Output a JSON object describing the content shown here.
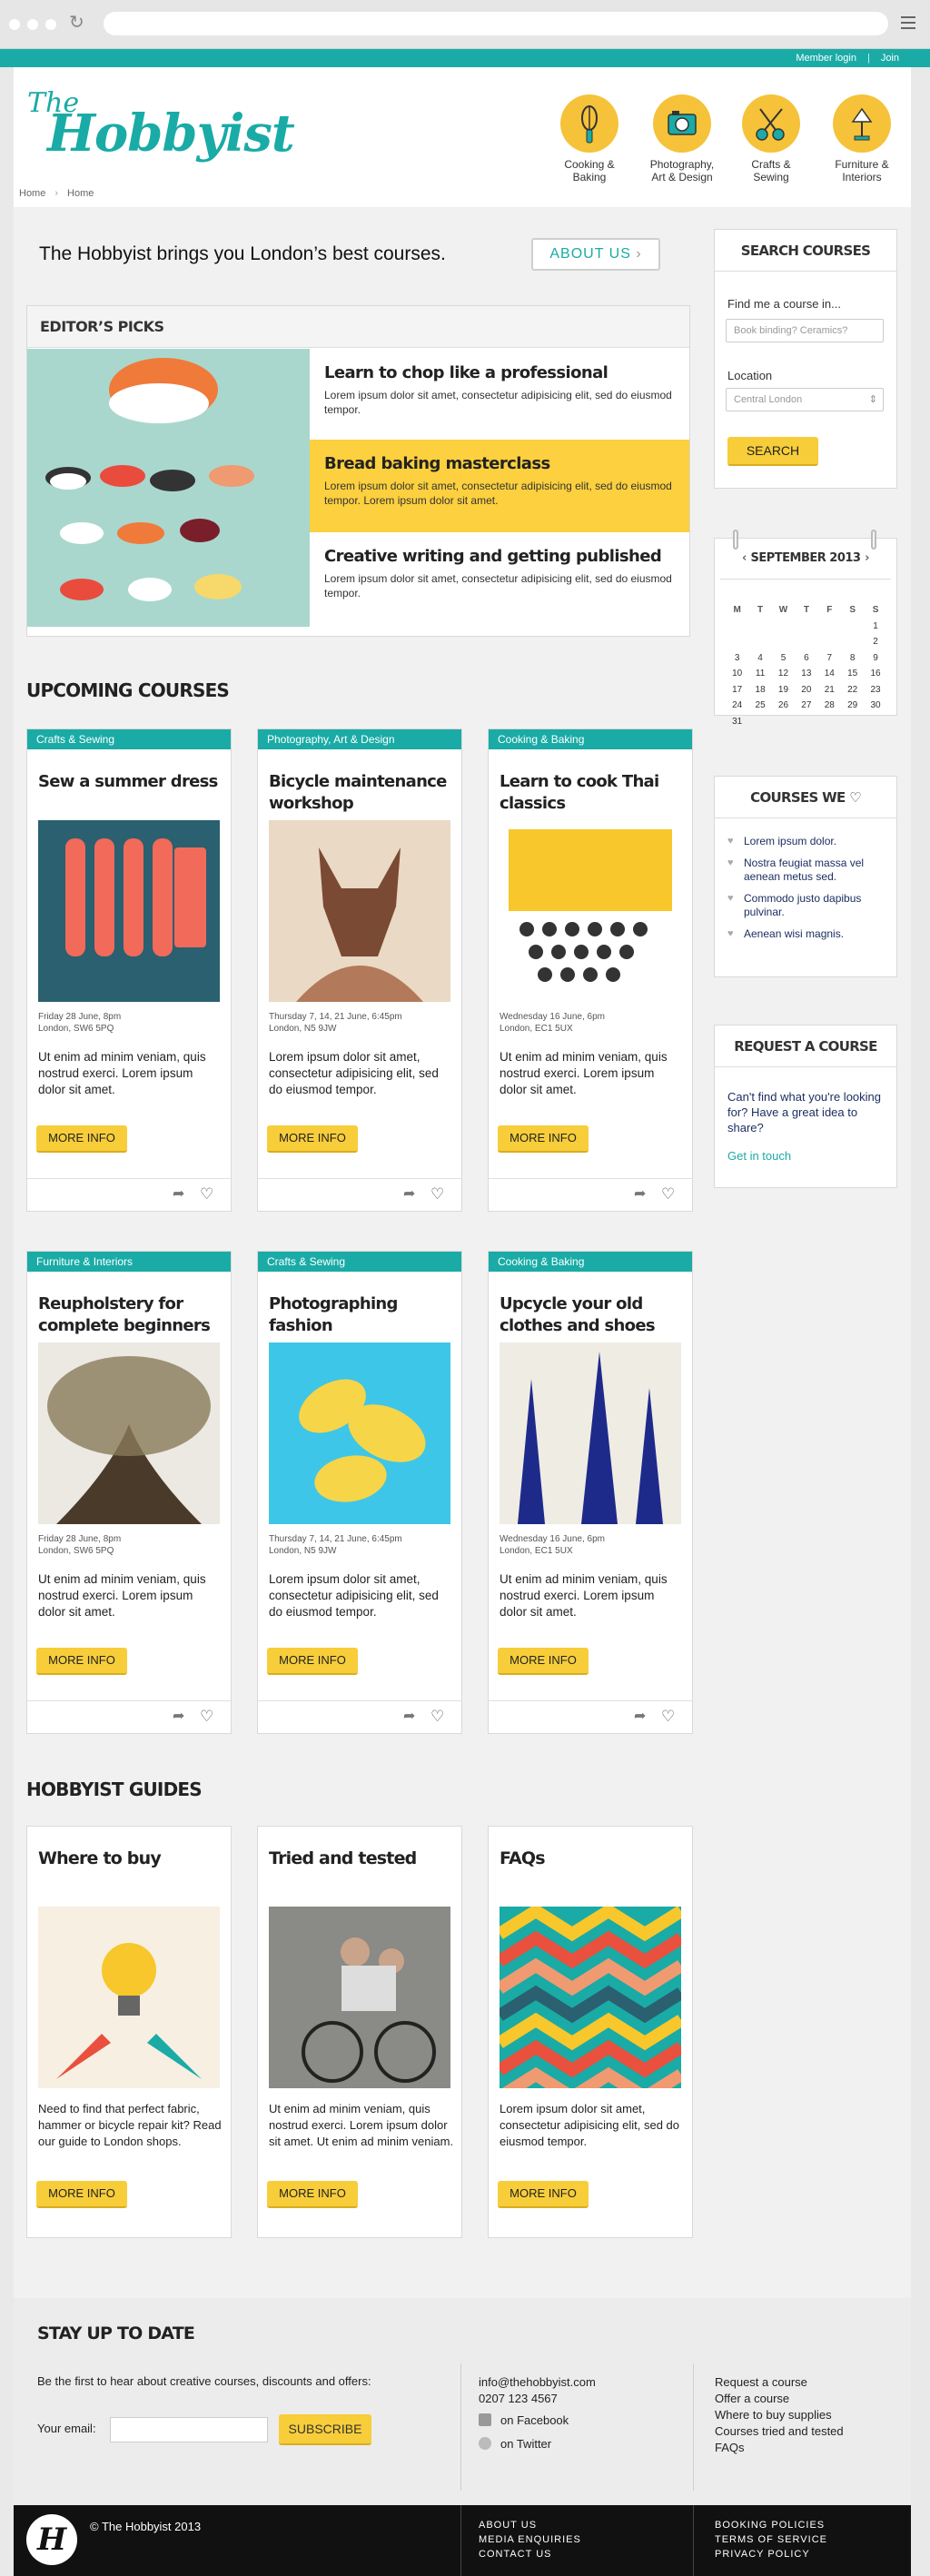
{
  "header": {
    "member_login": "Member login",
    "join": "Join",
    "logo_line1": "The",
    "logo_line2": "Hobbyist"
  },
  "categories": [
    {
      "label": "Cooking &\nBaking",
      "icon": "whisk-icon"
    },
    {
      "label": "Photography,\nArt & Design",
      "icon": "camera-icon"
    },
    {
      "label": "Crafts &\nSewing",
      "icon": "scissors-icon"
    },
    {
      "label": "Furniture &\nInteriors",
      "icon": "lamp-icon"
    }
  ],
  "breadcrumb": [
    "Home",
    "Home"
  ],
  "about": {
    "text": "The Hobbyist brings you London’s best courses.",
    "button": "ABOUT US"
  },
  "editors_picks": {
    "heading": "EDITOR’S PICKS",
    "items": [
      {
        "title": "Learn to chop like a professional",
        "desc": "Lorem ipsum dolor sit amet, consectetur adipisicing elit, sed do eiusmod tempor."
      },
      {
        "title": "Bread baking masterclass",
        "desc": "Lorem ipsum dolor sit amet, consectetur adipisicing elit, sed do eiusmod tempor. Lorem ipsum dolor sit amet."
      },
      {
        "title": "Creative writing and getting published",
        "desc": "Lorem ipsum dolor sit amet, consectetur adipisicing elit, sed do eiusmod tempor."
      }
    ]
  },
  "upcoming": {
    "heading": "UPCOMING COURSES",
    "more_label": "MORE INFO",
    "courses": [
      {
        "category": "Crafts & Sewing",
        "title": "Sew a summer dress",
        "date": "Friday 28 June, 8pm",
        "location": "London, SW6 5PQ",
        "desc": "Ut enim ad minim veniam, quis nostrud exerci. Lorem ipsum dolor sit amet."
      },
      {
        "category": "Photography, Art & Design",
        "title": "Bicycle maintenance workshop",
        "date": "Thursday 7, 14, 21 June, 6:45pm",
        "location": "London, N5 9JW",
        "desc": "Lorem ipsum dolor sit amet, consectetur adipisicing elit, sed do eiusmod tempor."
      },
      {
        "category": "Cooking & Baking",
        "title": "Learn to cook Thai classics",
        "date": "Wednesday 16 June, 6pm",
        "location": "London, EC1 5UX",
        "desc": "Ut enim ad minim veniam, quis nostrud exerci. Lorem ipsum dolor sit amet."
      },
      {
        "category": "Furniture & Interiors",
        "title": "Reupholstery for complete beginners",
        "date": "Friday 28 June, 8pm",
        "location": "London, SW6 5PQ",
        "desc": "Ut enim ad minim veniam, quis nostrud exerci. Lorem ipsum dolor sit amet."
      },
      {
        "category": "Crafts & Sewing",
        "title": "Photographing fashion",
        "date": "Thursday 7, 14, 21 June, 6:45pm",
        "location": "London, N5 9JW",
        "desc": "Lorem ipsum dolor sit amet, consectetur adipisicing elit, sed do eiusmod tempor."
      },
      {
        "category": "Cooking & Baking",
        "title": "Upcycle your old clothes and shoes",
        "date": "Wednesday 16 June, 6pm",
        "location": "London, EC1 5UX",
        "desc": "Ut enim ad minim veniam, quis nostrud exerci. Lorem ipsum dolor sit amet."
      }
    ]
  },
  "guides": {
    "heading": "HOBBYIST GUIDES",
    "more_label": "MORE INFO",
    "items": [
      {
        "title": "Where to buy",
        "desc": "Need to find that perfect fabric, hammer or bicycle repair kit? Read our guide to London shops."
      },
      {
        "title": "Tried and tested",
        "desc": "Ut enim ad minim veniam, quis nostrud exerci. Lorem ipsum dolor sit amet. Ut enim ad minim veniam."
      },
      {
        "title": "FAQs",
        "desc": "Lorem ipsum dolor sit amet, consectetur adipisicing elit, sed do eiusmod tempor."
      }
    ]
  },
  "search": {
    "heading": "SEARCH COURSES",
    "find_label": "Find me a course in...",
    "find_placeholder": "Book binding? Ceramics?",
    "location_label": "Location",
    "location_value": "Central London",
    "button": "SEARCH"
  },
  "calendar": {
    "month": "SEPTEMBER 2013",
    "days": [
      "M",
      "T",
      "W",
      "T",
      "F",
      "S",
      "S"
    ],
    "weeks": [
      [
        "",
        "",
        "",
        "",
        "",
        "",
        "1"
      ],
      [
        "",
        "",
        "",
        "",
        "",
        "",
        "2"
      ],
      [
        "3",
        "4",
        "5",
        "6",
        "7",
        "8",
        "9"
      ],
      [
        "10",
        "11",
        "12",
        "13",
        "14",
        "15",
        "16"
      ],
      [
        "17",
        "18",
        "19",
        "20",
        "21",
        "22",
        "23"
      ],
      [
        "24",
        "25",
        "26",
        "27",
        "28",
        "29",
        "30"
      ],
      [
        "31",
        "",
        "",
        "",
        "",
        "",
        ""
      ]
    ]
  },
  "courses_we_like": {
    "heading": "COURSES WE",
    "items": [
      "Lorem ipsum dolor.",
      "Nostra feugiat massa vel aenean metus sed.",
      "Commodo justo dapibus pulvinar.",
      "Aenean wisi magnis."
    ]
  },
  "request": {
    "heading": "REQUEST A COURSE",
    "text": "Can't find what you're looking for? Have a great idea to share?",
    "link": "Get in touch"
  },
  "footer": {
    "stay_heading": "STAY UP TO DATE",
    "stay_text": "Be the first to hear about creative courses, discounts and offers:",
    "email_label": "Your email:",
    "subscribe": "SUBSCRIBE",
    "email": "info@thehobbyist.com",
    "phone": "0207 123 4567",
    "facebook": "on Facebook",
    "twitter": "on Twitter",
    "links_right": [
      "Request a course",
      "Offer a course",
      "Where to buy supplies",
      "Courses tried and tested",
      "FAQs"
    ],
    "copyright": "© The Hobbyist 2013",
    "bottom_mid": [
      "ABOUT US",
      "MEDIA ENQUIRIES",
      "CONTACT US"
    ],
    "bottom_right": [
      "BOOKING POLICIES",
      "TERMS OF SERVICE",
      "PRIVACY POLICY"
    ],
    "logo_letter": "H"
  },
  "colors": {
    "teal": "#1aaba6",
    "yellow": "#f7cd3a",
    "category_circle": "#f5c23a"
  }
}
